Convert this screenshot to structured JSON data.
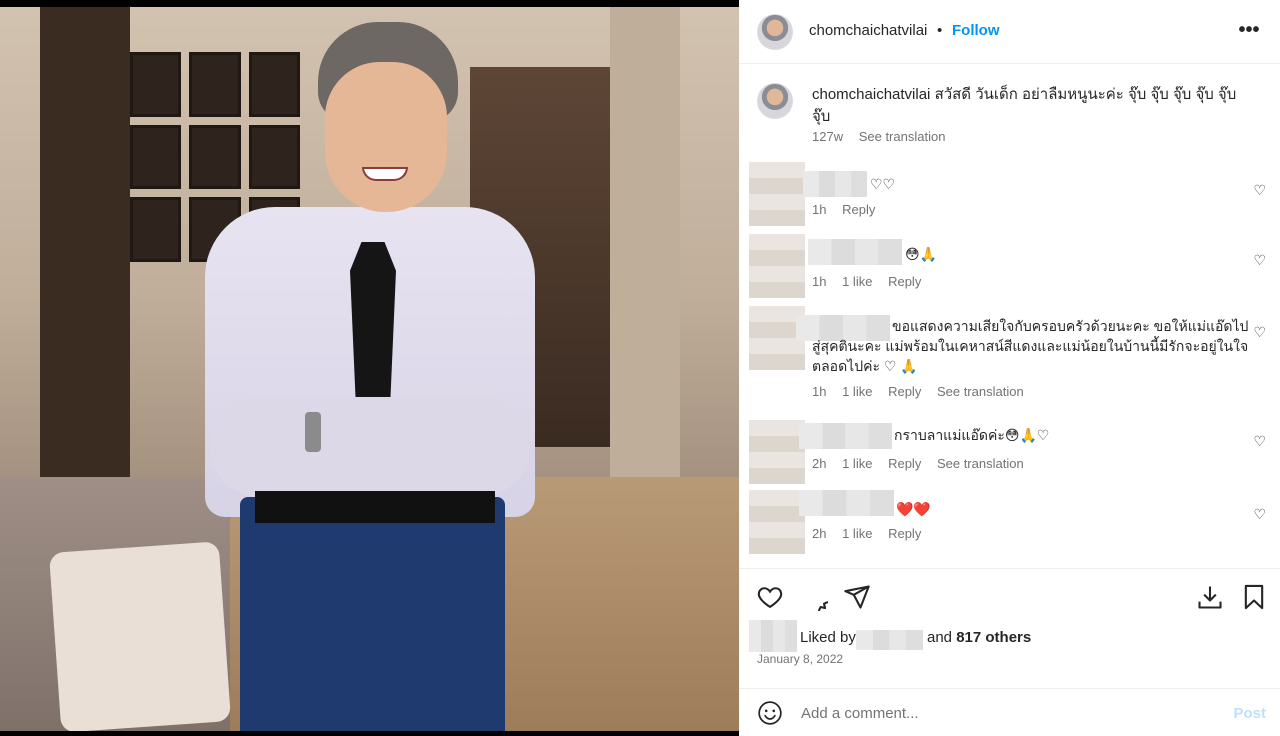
{
  "post": {
    "username": "chomchaichatvilai",
    "dot": "•",
    "follow_label": "Follow",
    "more_label": "•••",
    "caption_text": "สวัสดี วันเด็ก อย่าลืมหนูนะค่ะ จุ๊บ จุ๊บ จุ๊บ จุ๊บ จุ๊บ จุ๊บ",
    "caption_age": "127w",
    "see_translation": "See translation"
  },
  "comments": [
    {
      "text": "♡♡",
      "time": "1h",
      "likes": "",
      "reply": "Reply",
      "translate": ""
    },
    {
      "text": "😳🙏",
      "time": "1h",
      "likes": "1 like",
      "reply": "Reply",
      "translate": ""
    },
    {
      "text": "ขอแสดงความเสียใจกับครอบครัวด้วยนะคะ ขอให้แม่แอ๊ดไปสู่สุคตินะคะ แม่พร้อมในเคหาสน์สีแดงและแม่น้อยในบ้านนี้มีรักจะอยู่ในใจตลอดไปค่ะ ♡ 🙏",
      "time": "1h",
      "likes": "1 like",
      "reply": "Reply",
      "translate": "See translation"
    },
    {
      "text": "กราบลาแม่แอ๊ดค่ะ😳🙏♡",
      "time": "2h",
      "likes": "1 like",
      "reply": "Reply",
      "translate": "See translation"
    },
    {
      "text": "❤️❤️",
      "time": "2h",
      "likes": "1 like",
      "reply": "Reply",
      "translate": ""
    }
  ],
  "likes": {
    "liked_by": "Liked by",
    "and": "and",
    "others": "817 others"
  },
  "date": "January 8, 2022",
  "add_comment": {
    "placeholder": "Add a comment...",
    "post_label": "Post"
  },
  "colors": {
    "accent": "#0095f6",
    "post_disabled": "#c0dffd",
    "muted": "#737373"
  }
}
